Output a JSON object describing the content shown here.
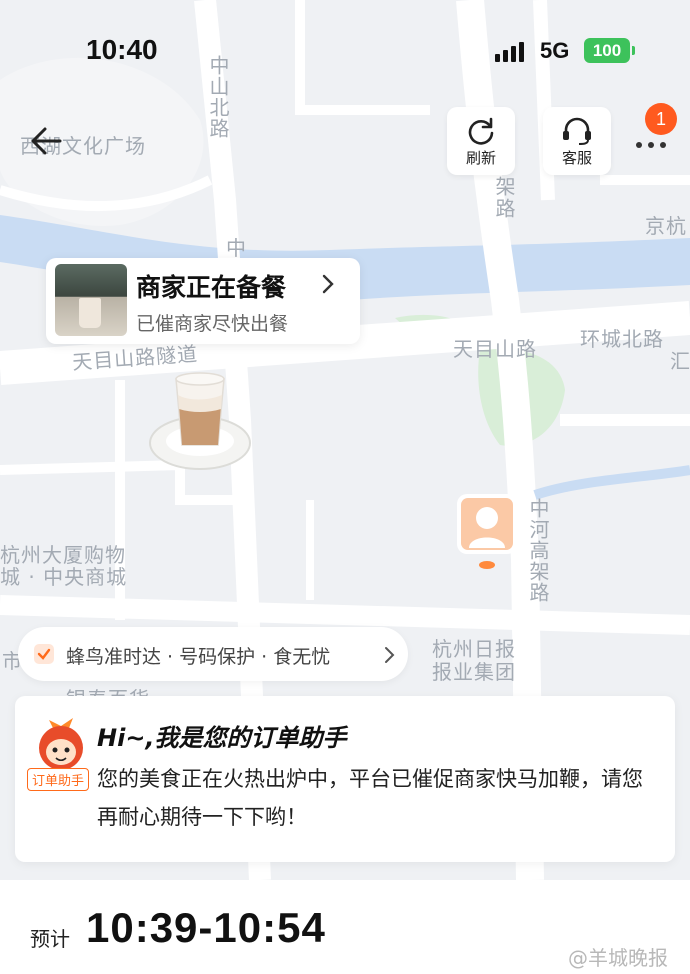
{
  "status_bar": {
    "time": "10:40",
    "network": "5G",
    "battery": "100"
  },
  "toolbar": {
    "refresh_label": "刷新",
    "service_label": "客服",
    "more_badge": "1"
  },
  "map": {
    "labels": {
      "plaza": "西湖文化广场",
      "zhongshan_north": "中山北路",
      "zhong": "中",
      "jia": "架",
      "lu": "路",
      "jinghang": "京杭",
      "tianmushan_tunnel": "天目山路隧道",
      "tianmushan_road": "天目山路",
      "huancheng_north": "环城北路",
      "hui": "汇",
      "mall_line1": "杭州大厦购物",
      "mall_line2": "城 · 中央商城",
      "zhonghe_elevated": "中河高架路",
      "press_line1": "杭州日报",
      "press_line2": "报业集团",
      "yintai": "银泰百货",
      "shi": "市"
    }
  },
  "merchant": {
    "status": "商家正在备餐",
    "note": "已催商家尽快出餐"
  },
  "guarantee": {
    "text": "蜂鸟准时达 · 号码保护 · 食无忧"
  },
  "assistant": {
    "tag": "订单助手",
    "title": "Hi~,我是您的订单助手",
    "message": "您的美食正在火热出炉中，平台已催促商家快马加鞭，请您再耐心期待一下下哟！"
  },
  "eta": {
    "label": "预计",
    "range": "10:39-10:54"
  },
  "watermark": "@羊城晚报",
  "colors": {
    "accent": "#ff6a1a",
    "badge": "#ff5a1f",
    "battery": "#3dc25b",
    "river": "#c9dcf3",
    "road": "#ffffff",
    "park": "#d9eed8"
  },
  "icons": {
    "back": "arrow-left-icon",
    "refresh": "refresh-icon",
    "service": "headset-icon",
    "more": "more-dots-icon",
    "check": "check-icon"
  }
}
